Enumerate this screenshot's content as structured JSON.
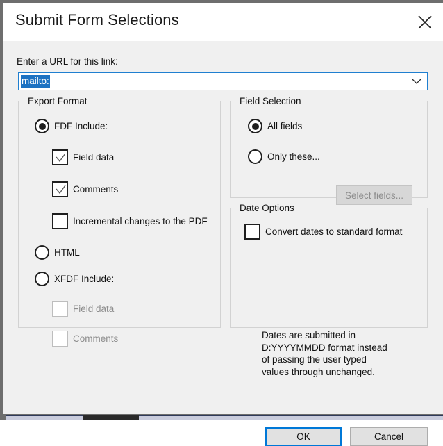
{
  "window": {
    "title": "Submit Form Selections",
    "close_icon": "close-icon"
  },
  "url_field": {
    "label": "Enter a URL for this link:",
    "value": "mailto:",
    "placeholder": "",
    "dropdown_icon": "chevron-down-icon",
    "selected": true,
    "selection_color": "#1d72c2",
    "focus_border_color": "#1f7fd0"
  },
  "export_format": {
    "title": "Export Format",
    "options": [
      {
        "label": "FDF  Include:",
        "checked": true
      },
      {
        "label": "HTML",
        "checked": false
      },
      {
        "label": "XFDF  Include:",
        "checked": false
      }
    ],
    "fdf_includes": [
      {
        "label": "Field data",
        "checked": true,
        "disabled": false
      },
      {
        "label": "Comments",
        "checked": true,
        "disabled": false
      },
      {
        "label": "Incremental changes to the PDF",
        "checked": false,
        "disabled": false
      }
    ],
    "xfdf_includes": [
      {
        "label": "Field data",
        "checked": false,
        "disabled": true
      },
      {
        "label": "Comments",
        "checked": false,
        "disabled": true
      }
    ]
  },
  "field_selection": {
    "title": "Field Selection",
    "options": [
      {
        "label": "All fields",
        "checked": true
      },
      {
        "label": "Only these...",
        "checked": false
      }
    ],
    "select_button": {
      "label": "Select fields...",
      "disabled": true
    }
  },
  "date_options": {
    "title": "Date Options",
    "convert": {
      "label": "Convert dates to standard format",
      "checked": false
    },
    "description": "Dates are submitted in D:YYYYMMDD format instead of passing the user typed values through unchanged."
  },
  "footer": {
    "ok_label": "OK",
    "cancel_label": "Cancel",
    "default_button": "OK",
    "accent_color": "#0078d7"
  }
}
